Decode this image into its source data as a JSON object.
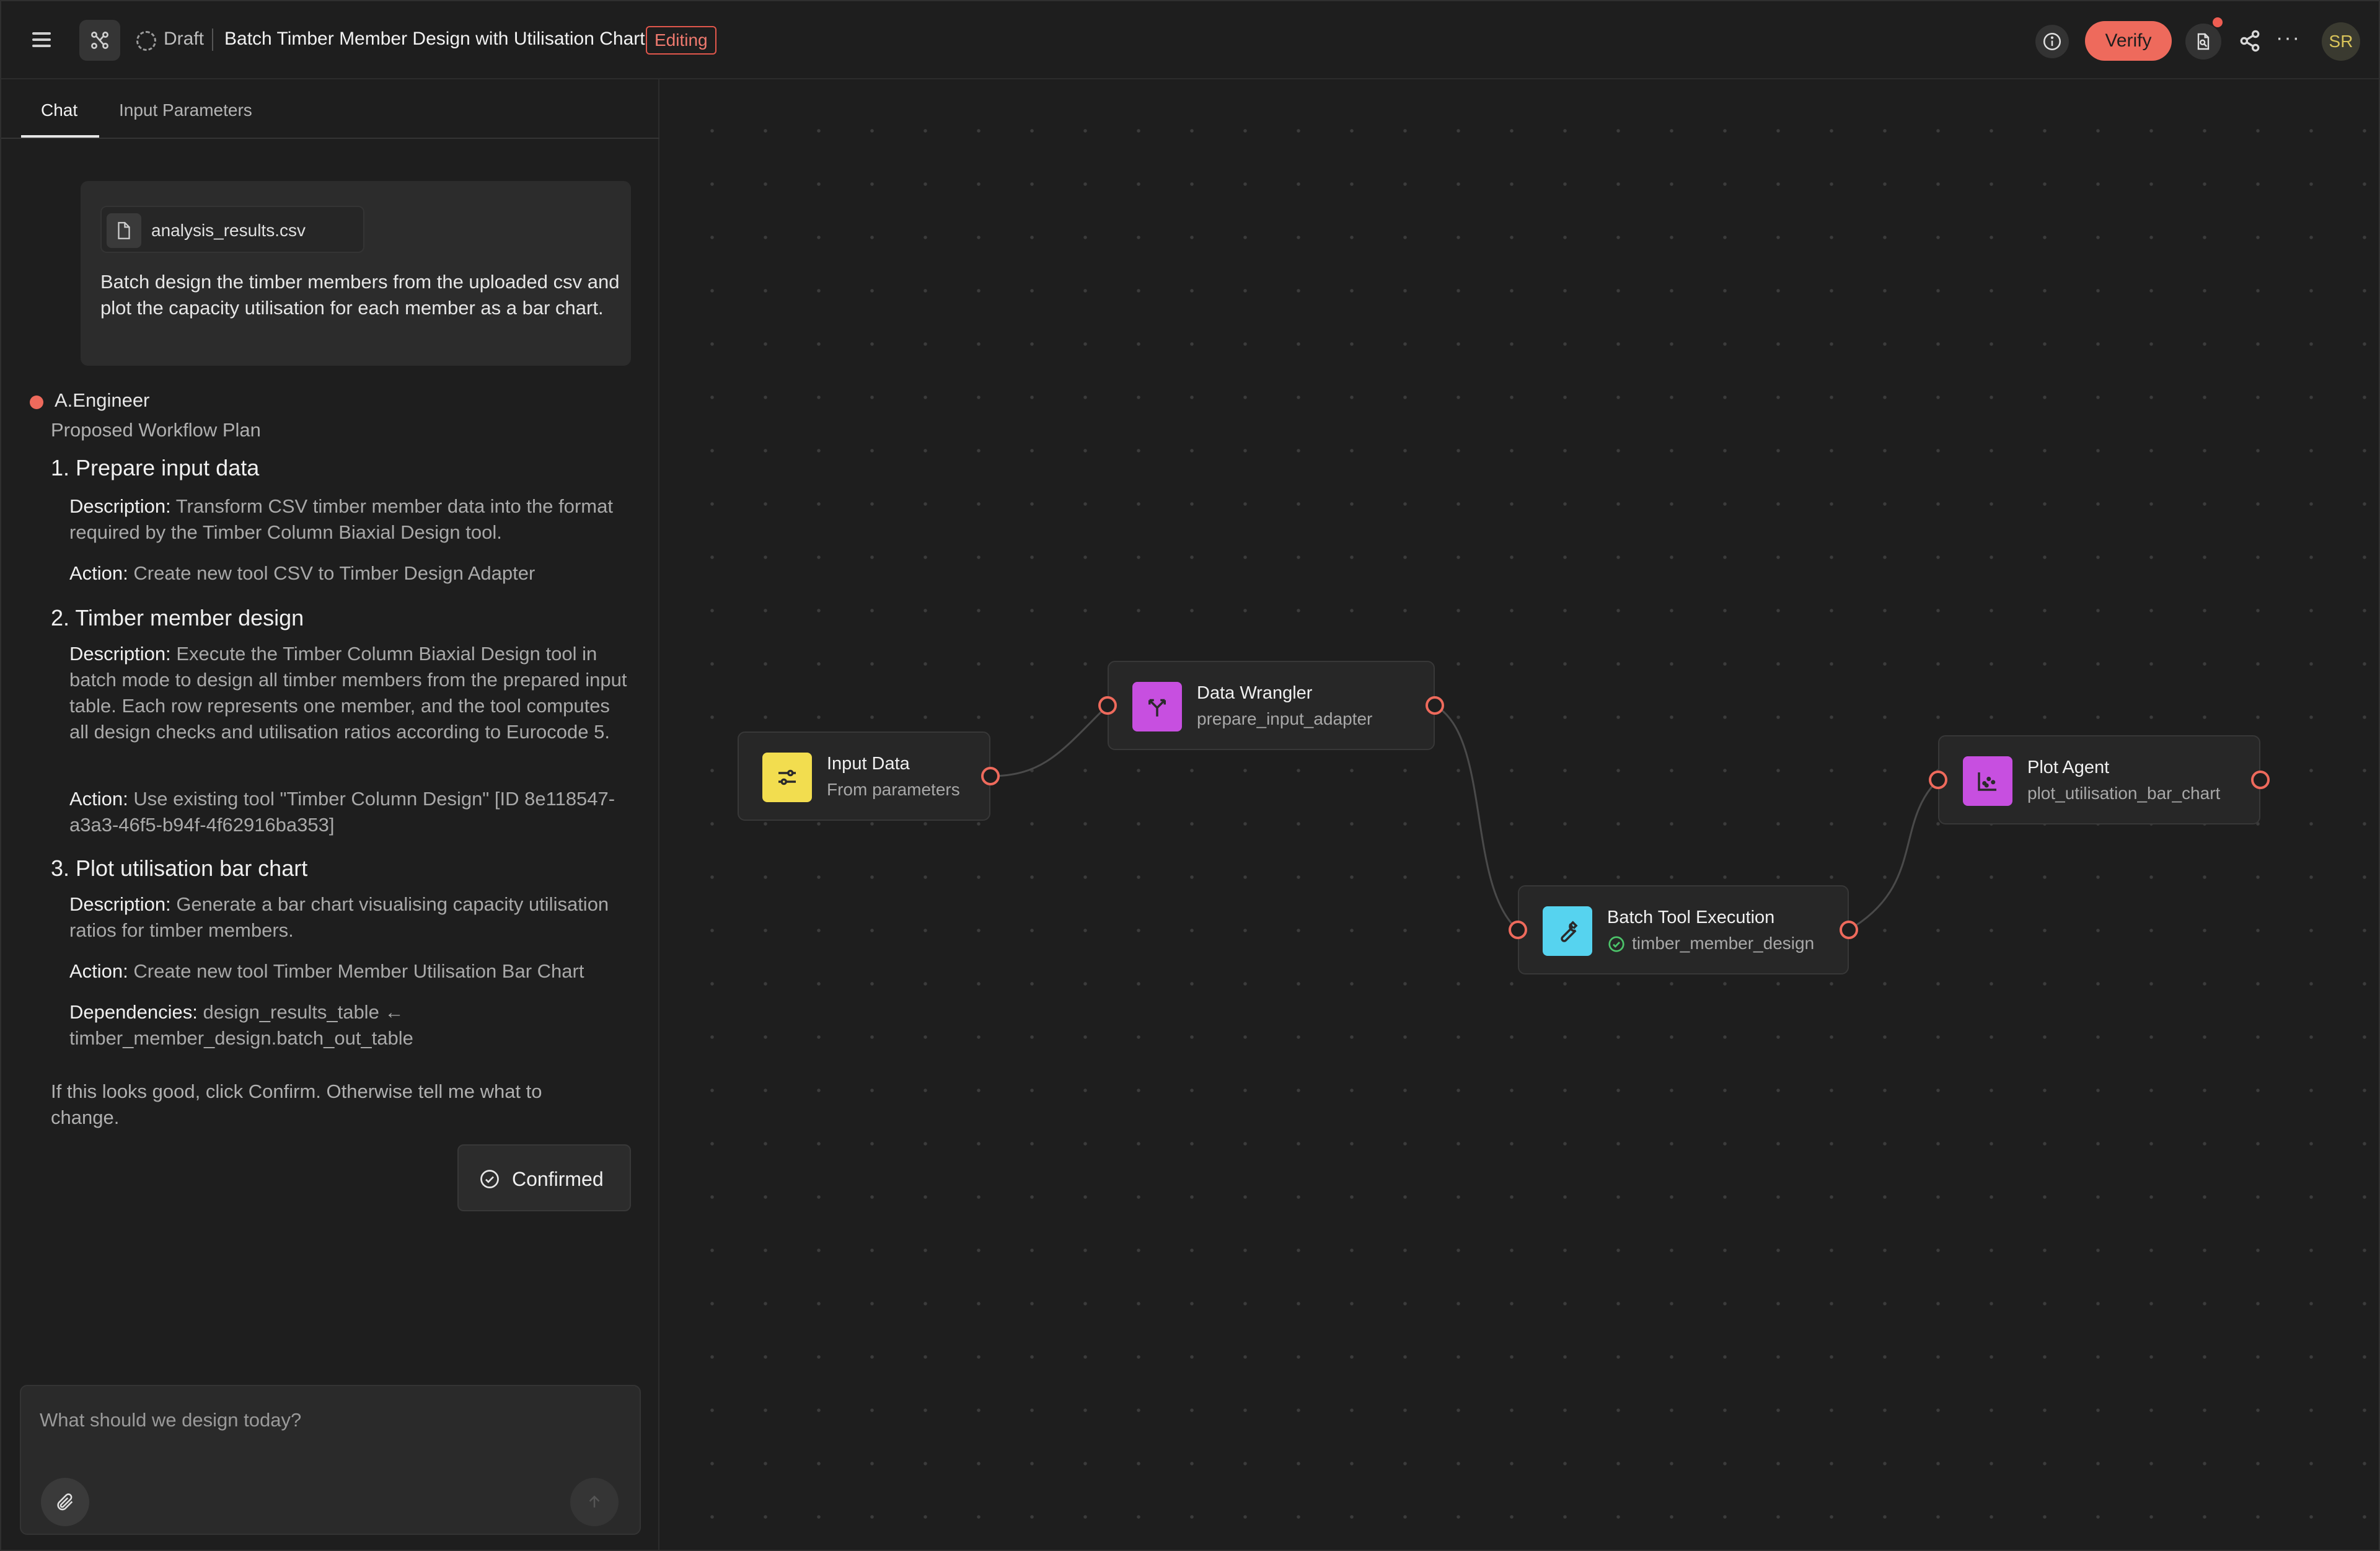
{
  "topbar": {
    "draft_label": "Draft",
    "title": "Batch Timber Member Design with Utilisation Chart",
    "status_badge": "Editing",
    "verify_label": "Verify",
    "more_label": "···",
    "avatar_initials": "SR"
  },
  "tabs": [
    {
      "label": "Chat",
      "active": true
    },
    {
      "label": "Input Parameters",
      "active": false
    }
  ],
  "chat": {
    "user_message": {
      "attachment": "analysis_results.csv",
      "text": "Batch design the timber members from the uploaded csv and plot the capacity utilisation for each member as a bar chart."
    },
    "agent": {
      "name": "A.Engineer",
      "subtitle": "Proposed Workflow Plan",
      "steps": [
        {
          "heading": "1. Prepare input data",
          "description_label": "Description:",
          "description": "Transform CSV timber member data into the format required by the Timber Column Biaxial Design tool.",
          "action_label": "Action:",
          "action": "Create new tool CSV to Timber Design Adapter"
        },
        {
          "heading": "2. Timber member design",
          "description_label": "Description:",
          "description": "Execute the Timber Column Biaxial Design tool in batch mode to design all timber members from the prepared input table. Each row represents one member, and the tool computes all design checks and utilisation ratios according to Eurocode 5.",
          "action_label": "Action:",
          "action": "Use existing tool \"Timber Column Design\" [ID 8e118547-a3a3-46f5-b94f-4f62916ba353]"
        },
        {
          "heading": "3. Plot utilisation bar chart",
          "description_label": "Description:",
          "description": "Generate a bar chart visualising capacity utilisation ratios for timber members.",
          "action_label": "Action:",
          "action": "Create new tool Timber Member Utilisation Bar Chart",
          "dependencies_label": "Dependencies:",
          "dependencies": "design_results_table ← timber_member_design.batch_out_table"
        }
      ],
      "closing": "If this looks good, click Confirm. Otherwise tell me what to change.",
      "confirmed_label": "Confirmed"
    },
    "composer": {
      "placeholder": "What should we design today?"
    }
  },
  "canvas": {
    "nodes": [
      {
        "id": "input",
        "title": "Input Data",
        "subtitle": "From parameters",
        "icon": "sliders-icon",
        "icon_color": "#f2dd4f"
      },
      {
        "id": "wrangler",
        "title": "Data Wrangler",
        "subtitle": "prepare_input_adapter",
        "icon": "merge-icon",
        "icon_color": "#c74fe0"
      },
      {
        "id": "batch",
        "title": "Batch Tool Execution",
        "subtitle": "timber_member_design",
        "icon": "wrench-icon",
        "icon_color": "#56d3ef",
        "status": "check-circle-icon"
      },
      {
        "id": "plot",
        "title": "Plot Agent",
        "subtitle": "plot_utilisation_bar_chart",
        "icon": "scatter-chart-icon",
        "icon_color": "#c74fe0"
      }
    ],
    "accent_color": "#ee6a5c"
  }
}
